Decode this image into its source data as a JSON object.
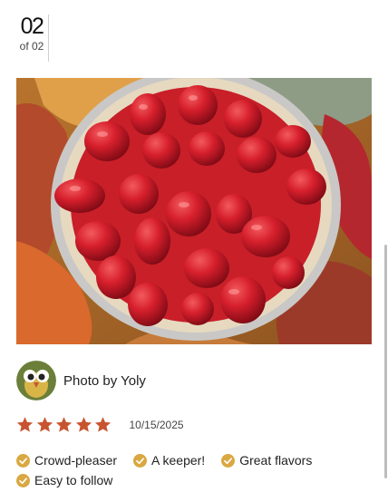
{
  "gallery": {
    "current": "02",
    "total_label": "of 02"
  },
  "photo": {
    "alt": "Strawberry pie"
  },
  "review": {
    "byline": "Photo by Yoly",
    "rating": 5,
    "max_rating": 5,
    "date": "10/15/2025",
    "tags": [
      "Crowd-pleaser",
      "A keeper!",
      "Great flavors",
      "Easy to follow"
    ]
  },
  "colors": {
    "star": "#c8542f",
    "check": "#d9a842",
    "text": "#222222"
  },
  "icons": {
    "star": "star-icon",
    "check": "checkmark-icon"
  }
}
